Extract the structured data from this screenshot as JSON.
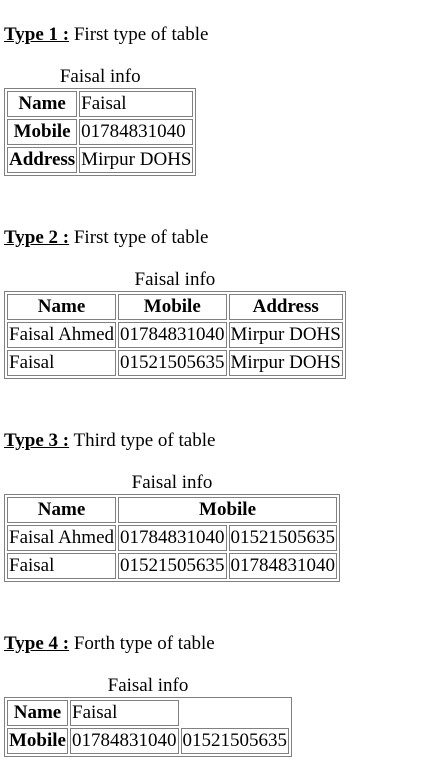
{
  "sections": [
    {
      "label": "Type 1 :",
      "desc": " First type of table",
      "caption": "Faisal info",
      "rows": [
        {
          "header": "Name",
          "value": "Faisal"
        },
        {
          "header": "Mobile",
          "value": "01784831040"
        },
        {
          "header": "Address",
          "value": "Mirpur DOHS"
        }
      ]
    },
    {
      "label": "Type 2 :",
      "desc": " First type of table",
      "caption": "Faisal info",
      "headers": [
        "Name",
        "Mobile",
        "Address"
      ],
      "rows": [
        [
          "Faisal Ahmed",
          "01784831040",
          "Mirpur DOHS"
        ],
        [
          "Faisal",
          "01521505635",
          "Mirpur DOHS"
        ]
      ]
    },
    {
      "label": "Type 3 :",
      "desc": " Third type of table",
      "caption": "Faisal info",
      "headers": [
        "Name",
        "Mobile"
      ],
      "rows": [
        [
          "Faisal Ahmed",
          "01784831040",
          "01521505635"
        ],
        [
          "Faisal",
          "01521505635",
          "01784831040"
        ]
      ]
    },
    {
      "label": "Type 4 :",
      "desc": " Forth type of table",
      "caption": "Faisal info",
      "rows": [
        {
          "header": "Name",
          "values": [
            "Faisal"
          ]
        },
        {
          "header": "Mobile",
          "values": [
            "01784831040",
            "01521505635"
          ]
        }
      ]
    }
  ]
}
